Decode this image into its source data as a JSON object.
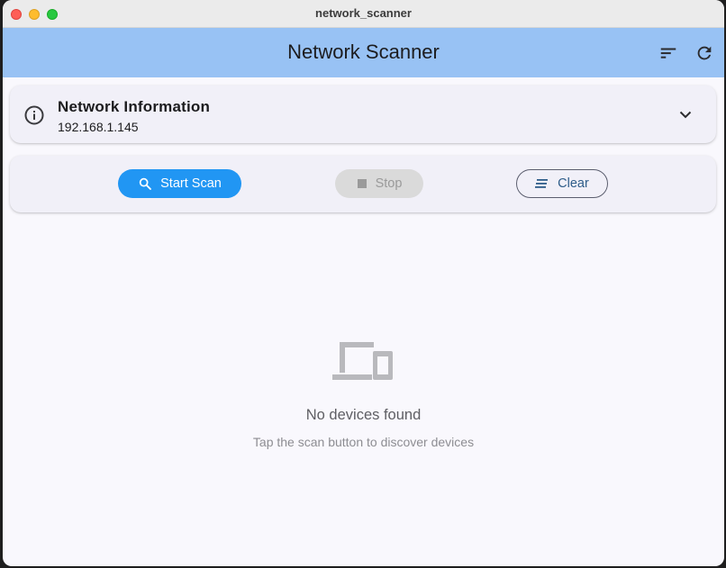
{
  "window": {
    "title": "network_scanner"
  },
  "appbar": {
    "title": "Network Scanner",
    "background": "#98c2f4",
    "actions": [
      {
        "icon": "sort-icon"
      },
      {
        "icon": "refresh-icon"
      }
    ]
  },
  "network_info": {
    "icon": "info-icon",
    "title": "Network Information",
    "ip": "192.168.1.145",
    "expand_icon": "chevron-down-icon"
  },
  "actions": {
    "start_label": "Start Scan",
    "start_icon": "search-icon",
    "start_color": "#2196f3",
    "stop_label": "Stop",
    "stop_icon": "stop-icon",
    "stop_enabled": false,
    "clear_label": "Clear",
    "clear_icon": "clear-all-icon"
  },
  "empty_state": {
    "icon": "devices-icon",
    "title": "No devices found",
    "subtitle": "Tap the scan button to discover devices"
  }
}
